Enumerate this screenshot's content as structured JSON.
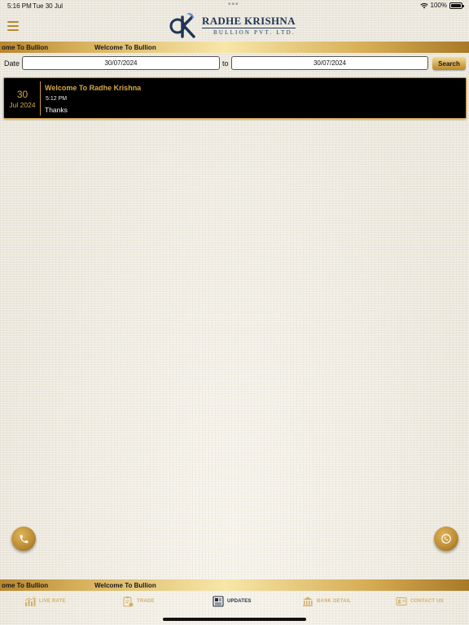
{
  "status_bar": {
    "time": "5:16 PM",
    "date": "Tue 30 Jul",
    "dots": "•••",
    "battery": "100%"
  },
  "header": {
    "brand_title": "RADHE KRISHNA",
    "brand_subtitle": "BULLION PVT. LTD."
  },
  "marquee": {
    "text_left": "ome To Bullion",
    "text_main": "Welcome To Bullion"
  },
  "filter": {
    "date_label": "Date",
    "from_value": "30/07/2024",
    "to_label": "to",
    "to_value": "30/07/2024",
    "search_label": "Search"
  },
  "updates": [
    {
      "day": "30",
      "month_year": "Jul 2024",
      "title": "Welcome To Radhe Krishna",
      "time": "5:12 PM",
      "message": "Thanks"
    }
  ],
  "bottom_marquee": {
    "text_left": "ome To Bullion",
    "text_main": "Welcome To Bullion"
  },
  "nav": {
    "live_rate": "LIVE RATE",
    "trade": "TRADE",
    "updates": "UPDATES",
    "bank_detail": "BANK DETAIL",
    "contact_us": "CONTACT US"
  },
  "colors": {
    "gold": "#d7a945",
    "navy": "#1f3557",
    "card_bg": "#000000",
    "inactive_nav": "#d4b06a"
  }
}
